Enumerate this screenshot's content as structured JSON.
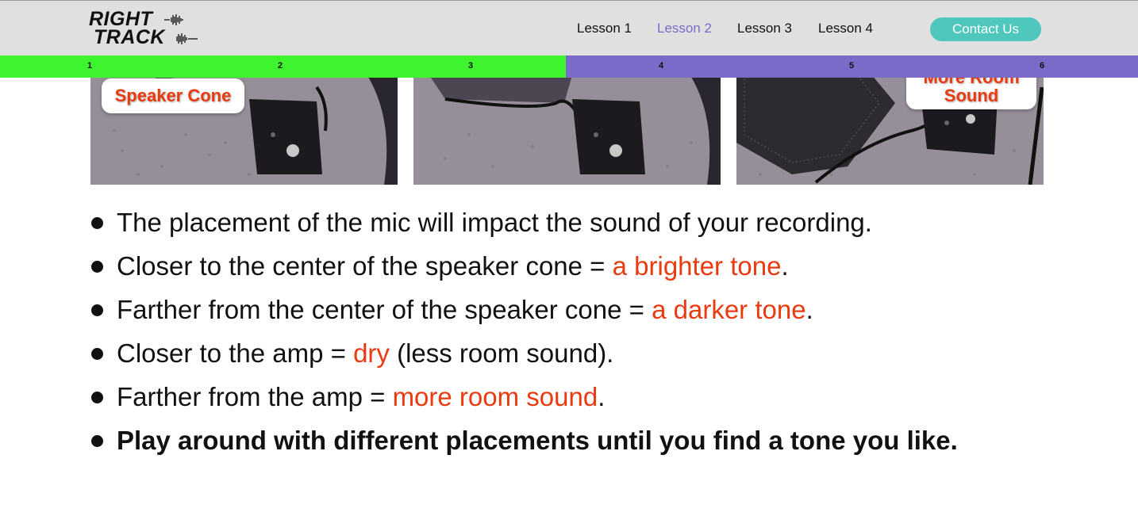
{
  "header": {
    "logo_line1": "RIGHT",
    "logo_line2": "TRACK",
    "nav": [
      "Lesson 1",
      "Lesson 2",
      "Lesson 3",
      "Lesson 4"
    ],
    "active_nav_index": 1,
    "contact_label": "Contact Us"
  },
  "progress": {
    "steps": [
      "1",
      "2",
      "3",
      "4",
      "5",
      "6"
    ],
    "current_step": 3,
    "fill_color": "#3ef42f",
    "track_color": "#7a6bc9"
  },
  "photos": {
    "callout_left": "Speaker Cone",
    "callout_right_line1": "More Room",
    "callout_right_line2": "Sound"
  },
  "bullets": [
    {
      "before": "The placement of the mic will impact the sound of your recording.",
      "highlight": "",
      "after": ""
    },
    {
      "before": "Closer to the center of the speaker cone = ",
      "highlight": "a brighter tone",
      "after": "."
    },
    {
      "before": "Farther from the center of the speaker cone = ",
      "highlight": "a darker tone",
      "after": "."
    },
    {
      "before": "Closer to the amp = ",
      "highlight": "dry",
      "after": " (less room sound)."
    },
    {
      "before": "Farther from the amp = ",
      "highlight": "more room sound",
      "after": "."
    },
    {
      "before": "Play around with different placements until you find a tone you like.",
      "highlight": "",
      "after": ""
    }
  ],
  "colors": {
    "accent": "#7a6bc9",
    "highlight": "#ea3a10",
    "button": "#4fc7bc"
  }
}
